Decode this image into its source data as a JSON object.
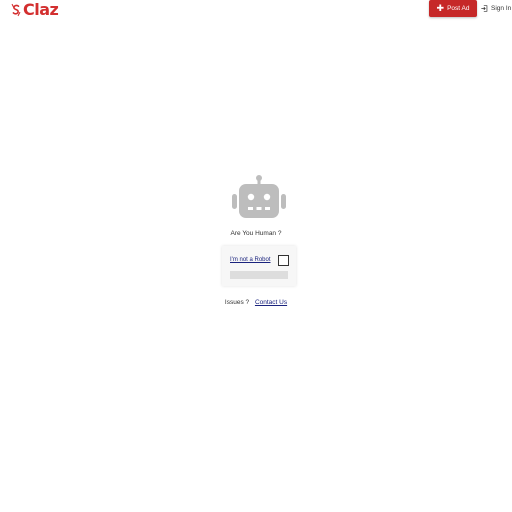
{
  "header": {
    "logo_text": "Claz",
    "post_ad_label": "Post Ad",
    "sign_in_label": "Sign In"
  },
  "main": {
    "question": "Are You Human ?",
    "captcha_label": "I'm not a Robot",
    "issues_label": "Issues ?",
    "contact_label": "Contact Us"
  },
  "colors": {
    "brand": "#c62828",
    "link": "#1a237e",
    "robot": "#bdbdbd"
  },
  "icons": [
    "claz-logo-icon",
    "plus-icon",
    "sign-in-icon",
    "robot-icon"
  ]
}
